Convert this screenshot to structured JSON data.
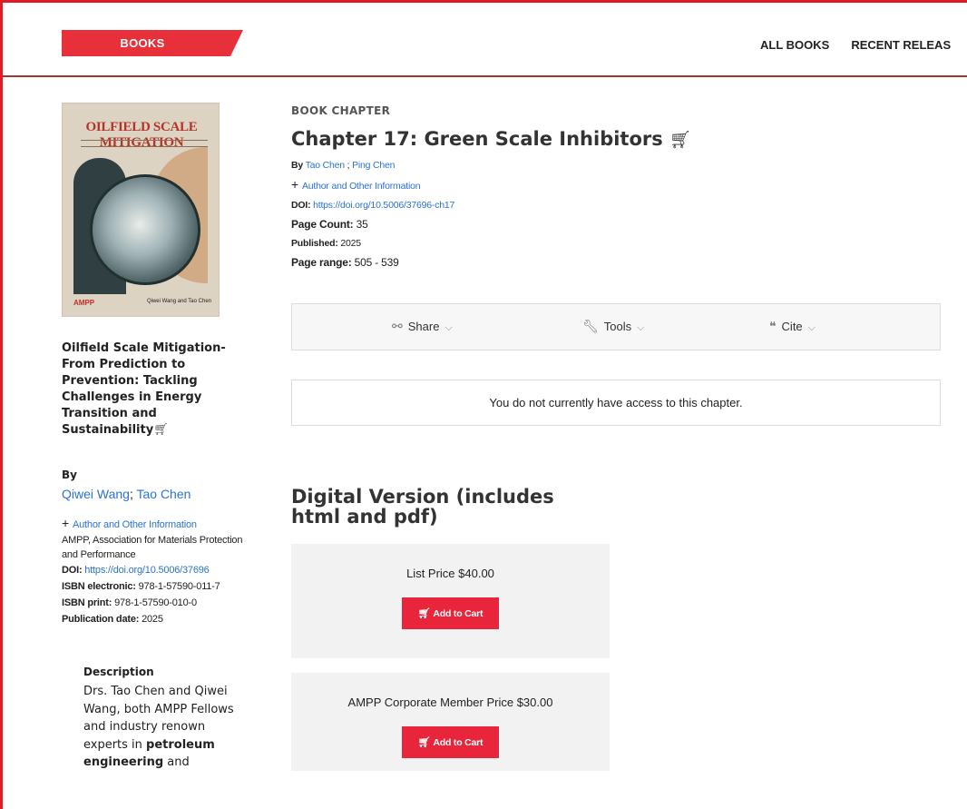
{
  "header": {
    "section_tab": "BOOKS",
    "nav": [
      "ALL BOOKS",
      "RECENT RELEAS"
    ]
  },
  "book": {
    "cover": {
      "title_art": "OILFIELD SCALE MITIGATION",
      "publisher_logo": "AMPP",
      "authors": "Qiwei Wang and Tao Chen"
    },
    "title": "Oilfield Scale Mitigation-From Prediction to Prevention: Tackling Challenges in Energy Transition and Sustainability",
    "by_label": "By",
    "authors": [
      "Qiwei Wang",
      "Tao Chen"
    ],
    "author_separator": ";",
    "author_info_link": "Author and Other Information",
    "publisher": "AMPP, Association for Materials Protection and Performance",
    "doi_label": "DOI:",
    "doi": "https://doi.org/10.5006/37696",
    "isbn_electronic_label": "ISBN electronic:",
    "isbn_electronic": "978-1-57590-011-7",
    "isbn_print_label": "ISBN print:",
    "isbn_print": "978-1-57590-010-0",
    "pubdate_label": "Publication date:",
    "pubdate": "2025",
    "description_heading": "Description",
    "description_pre": "Drs. Tao Chen and Qiwei Wang, both AMPP Fellows and industry renown experts in ",
    "description_bold1": "petroleum engineering",
    "description_mid": " and"
  },
  "chapter": {
    "kicker": "BOOK CHAPTER",
    "title": "Chapter 17: Green Scale Inhibitors",
    "by_label": "By",
    "authors": [
      "Tao Chen",
      "Ping Chen"
    ],
    "author_separator": ";",
    "author_info_link": "Author and Other Information",
    "doi_label": "DOI:",
    "doi": "https://doi.org/10.5006/37696-ch17",
    "page_count_label": "Page Count:",
    "page_count": "35",
    "published_label": "Published:",
    "published": "2025",
    "page_range_label": "Page range:",
    "page_range": "505 - 539"
  },
  "toolbar": {
    "share": "Share",
    "tools": "Tools",
    "cite": "Cite"
  },
  "access_message": "You do not currently have access to this chapter.",
  "purchase": {
    "heading": "Digital Version (includes html and pdf)",
    "options": [
      {
        "label": "List Price $40.00",
        "button": "Add to Cart"
      },
      {
        "label": "AMPP Corporate Member Price $30.00",
        "button": "Add to Cart"
      }
    ]
  },
  "colors": {
    "accent_red": "#e8303a",
    "link_blue": "#2b73d6"
  }
}
